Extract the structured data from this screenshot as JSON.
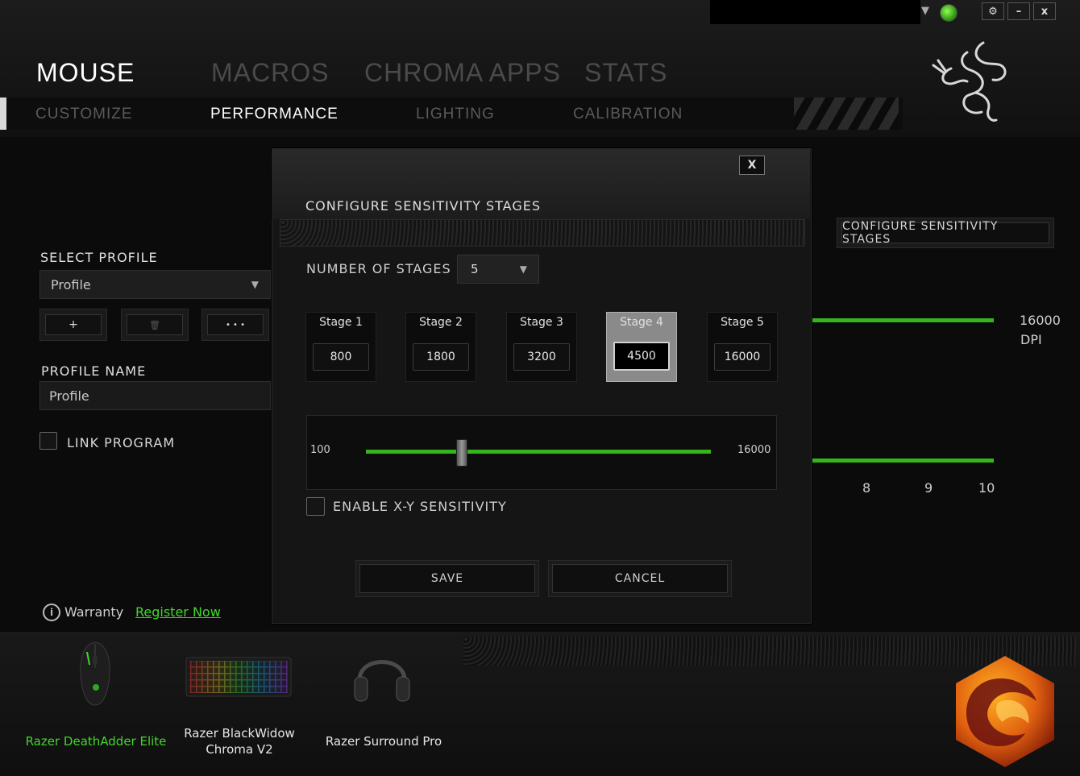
{
  "window": {
    "settings_glyph": "⚙",
    "minimize_glyph": "–",
    "close_glyph": "x",
    "status_arrow": "▼"
  },
  "main_tabs": [
    {
      "label": "MOUSE",
      "active": true
    },
    {
      "label": "MACROS",
      "active": false
    },
    {
      "label": "CHROMA APPS",
      "active": false
    },
    {
      "label": "STATS",
      "active": false
    }
  ],
  "sub_tabs": [
    {
      "label": "CUSTOMIZE",
      "active": false
    },
    {
      "label": "PERFORMANCE",
      "active": true
    },
    {
      "label": "LIGHTING",
      "active": false
    },
    {
      "label": "CALIBRATION",
      "active": false
    }
  ],
  "left_panel": {
    "select_profile_label": "SELECT PROFILE",
    "profile_value": "Profile",
    "add_glyph": "+",
    "delete_glyph": "🗑",
    "more_glyph": "• • •",
    "profile_name_label": "PROFILE NAME",
    "profile_name_value": "Profile",
    "link_program_label": "LINK PROGRAM",
    "warranty_icon": "i",
    "warranty_label": "Warranty",
    "register_link": "Register Now"
  },
  "background_panel": {
    "configure_button": "CONFIGURE SENSITIVITY STAGES",
    "dpi_value": "16000",
    "dpi_unit": "DPI",
    "axis_numbers": [
      "8",
      "9",
      "10"
    ]
  },
  "dialog": {
    "close_label": "X",
    "title": "CONFIGURE SENSITIVITY STAGES",
    "number_of_stages_label": "NUMBER OF STAGES",
    "number_of_stages_value": "5",
    "dropdown_glyph": "▼",
    "stages": [
      {
        "label": "Stage 1",
        "value": "800",
        "active": false
      },
      {
        "label": "Stage 2",
        "value": "1800",
        "active": false
      },
      {
        "label": "Stage 3",
        "value": "3200",
        "active": false
      },
      {
        "label": "Stage 4",
        "value": "4500",
        "active": true
      },
      {
        "label": "Stage 5",
        "value": "16000",
        "active": false
      }
    ],
    "slider_min": "100",
    "slider_max": "16000",
    "slider_value": 4500,
    "enable_xy_label": "ENABLE X-Y SENSITIVITY",
    "save_label": "SAVE",
    "cancel_label": "CANCEL"
  },
  "devices": [
    {
      "name": "Razer DeathAdder Elite",
      "active": true
    },
    {
      "name_line1": "Razer BlackWidow",
      "name_line2": "Chroma V2",
      "active": false
    },
    {
      "name": "Razer Surround Pro",
      "active": false
    }
  ],
  "colors": {
    "accent_green": "#44d62c",
    "slider_green": "#36b41c",
    "active_tab": "#ffffff",
    "inactive_tab": "#4a4a4a"
  }
}
